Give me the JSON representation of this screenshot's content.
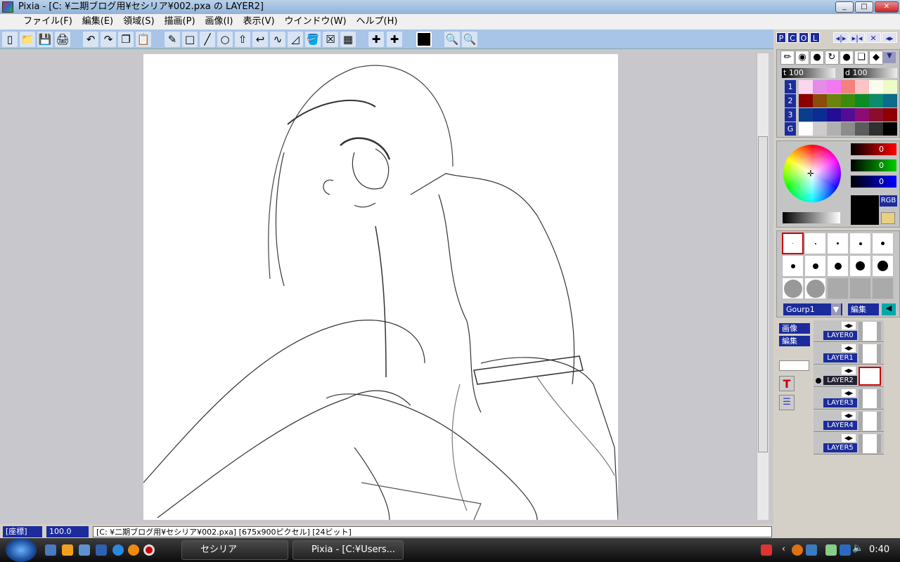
{
  "window": {
    "title": "Pixia - [C:                              ¥二期ブログ用¥セシリア¥002.pxa の LAYER2]",
    "min": "_",
    "max": "□",
    "close": "✕"
  },
  "menu": [
    "ファイル(F)",
    "編集(E)",
    "領域(S)",
    "描画(P)",
    "画像(I)",
    "表示(V)",
    "ウインドウ(W)",
    "ヘルプ(H)"
  ],
  "toolbar": [
    "new",
    "open",
    "save",
    "print",
    "undo",
    "redo",
    "copy",
    "paste",
    "pen",
    "rectangle",
    "line",
    "circle",
    "lasso",
    "curve",
    "bezier",
    "polygon",
    "fill",
    "clear",
    "transparency",
    "stamp",
    "stamp-alt",
    "color",
    "zoom-in",
    "zoom-out"
  ],
  "panel": {
    "tabs": [
      "P",
      "C",
      "O",
      "L"
    ],
    "tab_buttons": [
      "◂|▸",
      "▸|◂",
      "✕",
      "◂▸"
    ],
    "tools": [
      "pencil",
      "airbrush",
      "brush",
      "smudge",
      "blur",
      "overlay",
      "eraser"
    ],
    "t_label": "t",
    "t_value": "100",
    "d_label": "d",
    "d_value": "100",
    "palette_rows": [
      {
        "label": "1",
        "colors": [
          "#fcd6ec",
          "#e48ce8",
          "#f478f4",
          "#f48080",
          "#fcc4c4",
          "#fcfcec",
          "#ecfcc4"
        ]
      },
      {
        "label": "2",
        "colors": [
          "#8c0000",
          "#8c4c0c",
          "#6c840c",
          "#3c8c0c",
          "#0c8c24",
          "#0c8c6c",
          "#0c6c8c"
        ]
      },
      {
        "label": "3",
        "colors": [
          "#0c3c8c",
          "#0c2c94",
          "#240c94",
          "#540c94",
          "#8c0c74",
          "#8c0c2c",
          "#8c0000"
        ]
      },
      {
        "label": "G",
        "colors": [
          "#ffffff",
          "#cccccc",
          "#b0b0b0",
          "#8c8c8c",
          "#5c5c5c",
          "#303030",
          "#000000"
        ]
      }
    ],
    "rgb": {
      "r": "0",
      "g": "0",
      "b": "0",
      "mode": "RGB"
    },
    "current_color": "#000000",
    "group": "Gourp1",
    "edit": "編集",
    "layer_buttons": [
      "画像",
      "編集"
    ],
    "layers": [
      "LAYER0",
      "LAYER1",
      "LAYER2",
      "LAYER3",
      "LAYER4",
      "LAYER5"
    ],
    "active_layer": "LAYER2"
  },
  "status": {
    "coord": "[座標]",
    "zoom": "100.0",
    "file": "[C:                              ¥二期ブログ用¥セシリア¥002.pxa] [675x900ピクセル] [24ビット]"
  },
  "taskbar": {
    "tasks": [
      "セシリア",
      "Pixia - [C:¥Users..."
    ],
    "clock": "0:40"
  }
}
